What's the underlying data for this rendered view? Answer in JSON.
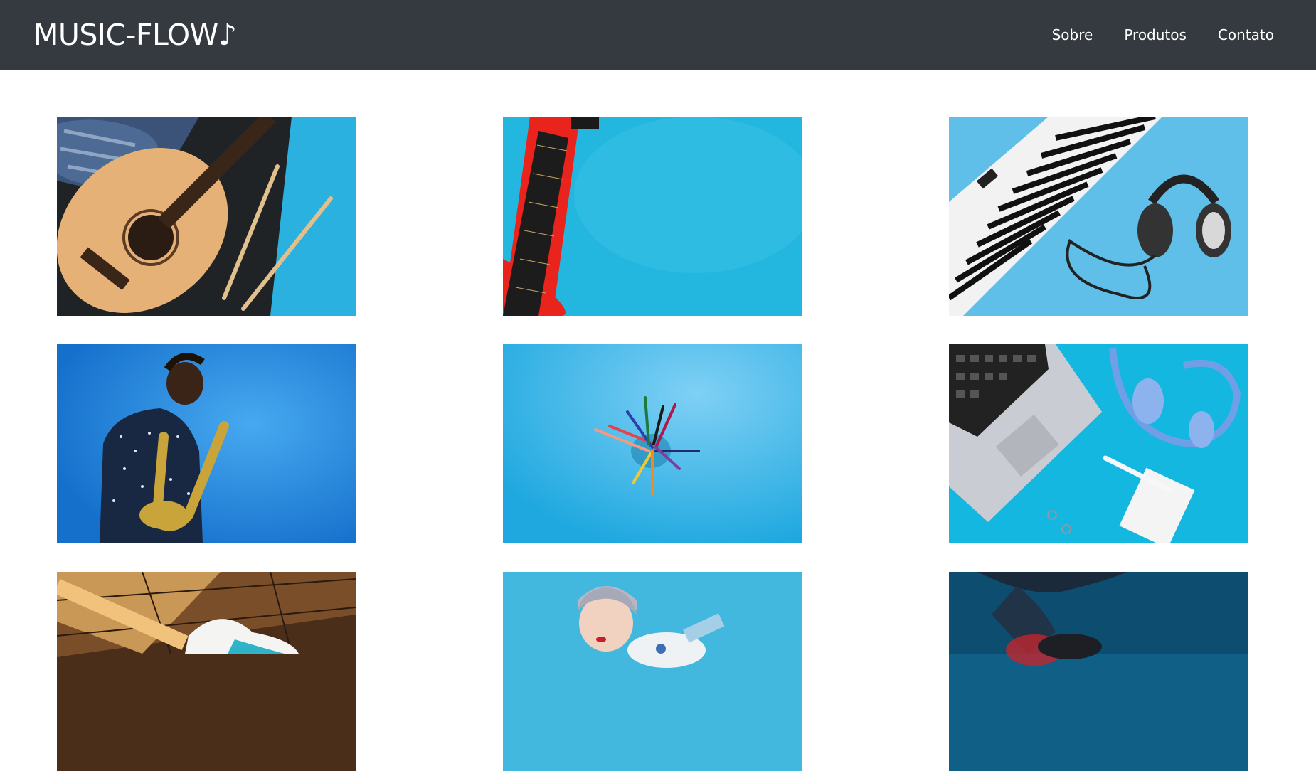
{
  "header": {
    "logo": "MUSIC-FLOW♪",
    "nav": [
      {
        "label": "Sobre"
      },
      {
        "label": "Produtos"
      },
      {
        "label": "Contato"
      }
    ]
  },
  "gallery": {
    "items": [
      {
        "icon": "acoustic-guitar-drumsticks-image"
      },
      {
        "icon": "red-ukulele-image"
      },
      {
        "icon": "keyboard-headphones-image"
      },
      {
        "icon": "saxophone-player-image"
      },
      {
        "icon": "colored-pencils-image"
      },
      {
        "icon": "laptop-headphones-image"
      },
      {
        "icon": "electric-guitar-image"
      },
      {
        "icon": "woman-with-guitar-image"
      },
      {
        "icon": "guitarist-dark-image"
      }
    ]
  },
  "colors": {
    "header_bg": "#343a40",
    "accent_blue": "#29b6e6"
  }
}
